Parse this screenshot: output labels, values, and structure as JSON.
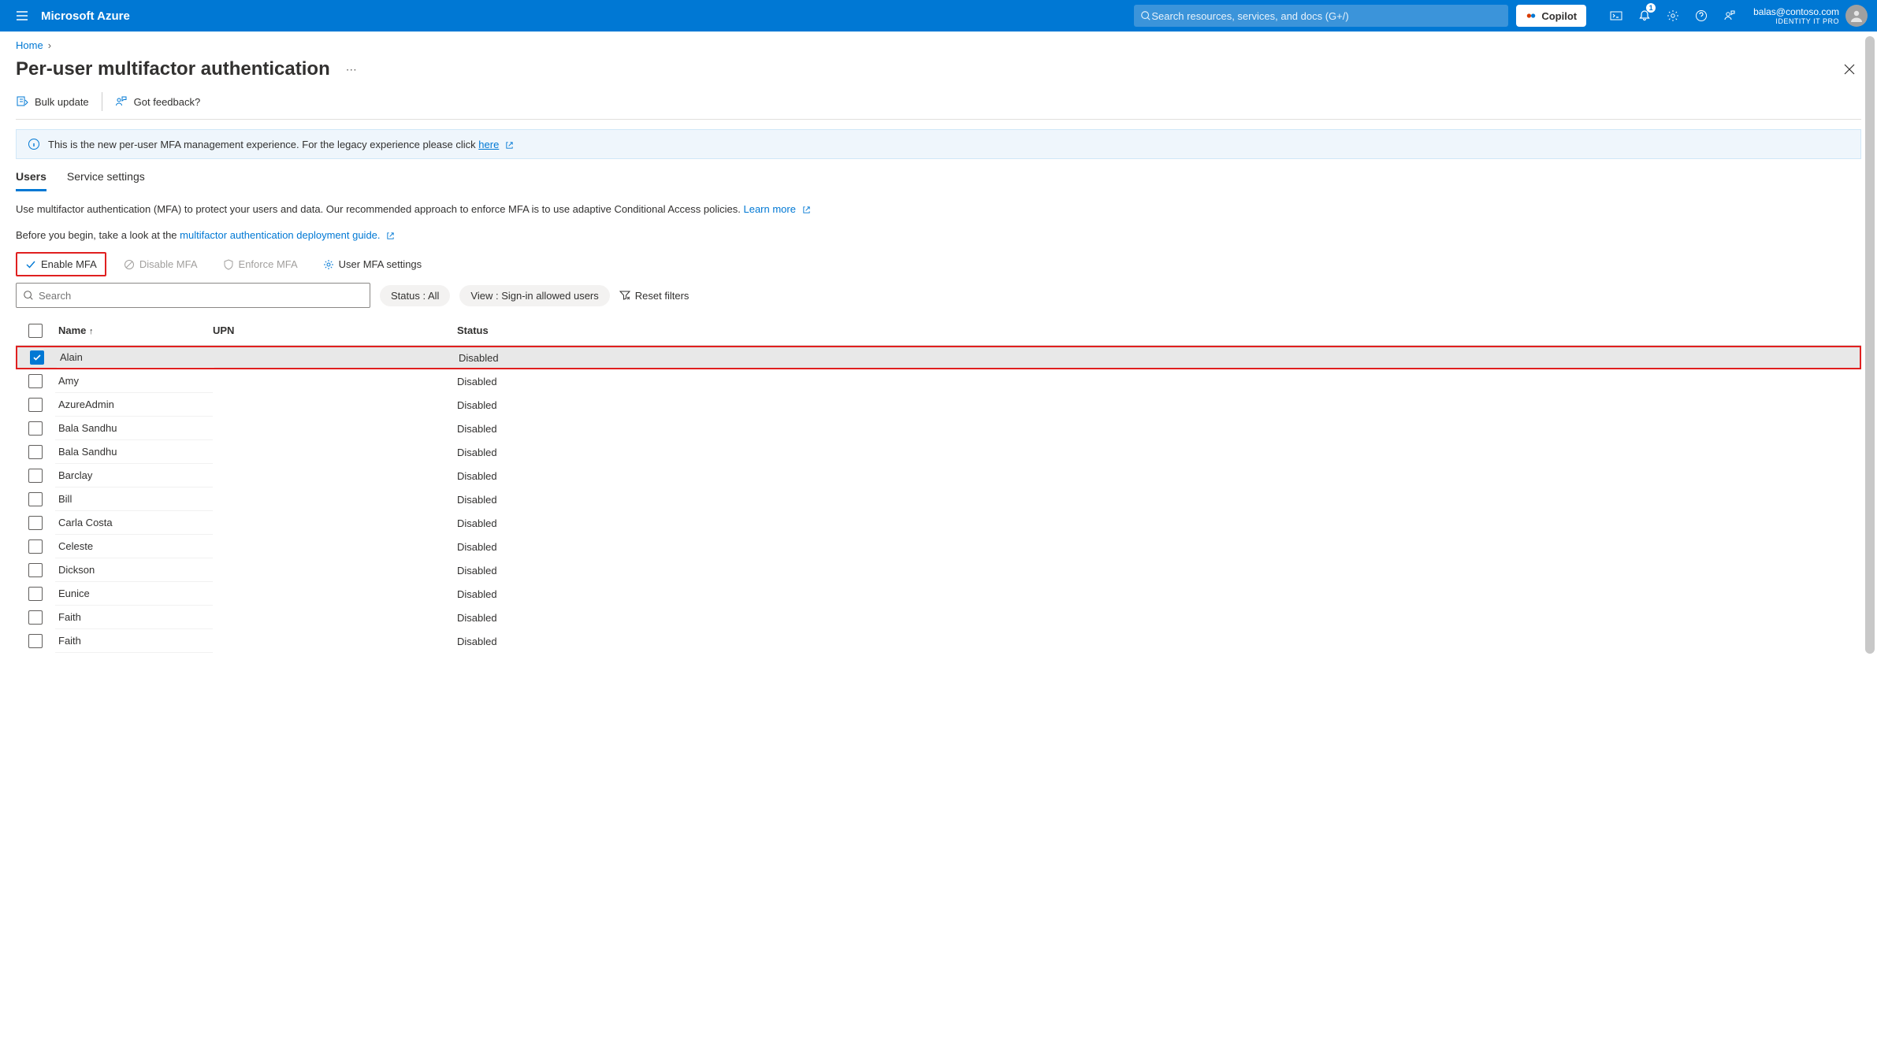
{
  "header": {
    "brand": "Microsoft Azure",
    "search_placeholder": "Search resources, services, and docs (G+/)",
    "copilot": "Copilot",
    "notification_count": "1",
    "account_email": "balas@contoso.com",
    "account_role": "IDENTITY IT PRO"
  },
  "breadcrumb": {
    "home": "Home"
  },
  "page": {
    "title": "Per-user multifactor authentication",
    "bulk_update": "Bulk update",
    "feedback": "Got feedback?"
  },
  "banner": {
    "text": "This is the new per-user MFA management experience. For the legacy experience please click ",
    "link": "here"
  },
  "tabs": {
    "users": "Users",
    "settings": "Service settings"
  },
  "intro": {
    "line1a": "Use multifactor authentication (MFA) to protect your users and data. Our recommended approach to enforce MFA is to use adaptive Conditional Access policies. ",
    "line1_link": "Learn more",
    "line2a": "Before you begin, take a look at the ",
    "line2_link": "multifactor authentication deployment guide."
  },
  "actions": {
    "enable": "Enable MFA",
    "disable": "Disable MFA",
    "enforce": "Enforce MFA",
    "user_settings": "User MFA settings"
  },
  "filters": {
    "search_placeholder": "Search",
    "status_pill": "Status : All",
    "view_pill": "View : Sign-in allowed users",
    "reset": "Reset filters"
  },
  "columns": {
    "name": "Name",
    "upn": "UPN",
    "status": "Status"
  },
  "rows": [
    {
      "name": "Alain",
      "upn": "",
      "status": "Disabled",
      "checked": true,
      "highlight": true
    },
    {
      "name": "Amy",
      "upn": "",
      "status": "Disabled",
      "checked": false
    },
    {
      "name": "AzureAdmin",
      "upn": "",
      "status": "Disabled",
      "checked": false
    },
    {
      "name": "Bala Sandhu",
      "upn": "",
      "status": "Disabled",
      "checked": false
    },
    {
      "name": "Bala Sandhu",
      "upn": "",
      "status": "Disabled",
      "checked": false
    },
    {
      "name": "Barclay",
      "upn": "",
      "status": "Disabled",
      "checked": false
    },
    {
      "name": "Bill",
      "upn": "",
      "status": "Disabled",
      "checked": false
    },
    {
      "name": "Carla Costa",
      "upn": "",
      "status": "Disabled",
      "checked": false
    },
    {
      "name": "Celeste",
      "upn": "",
      "status": "Disabled",
      "checked": false
    },
    {
      "name": "Dickson",
      "upn": "",
      "status": "Disabled",
      "checked": false
    },
    {
      "name": "Eunice",
      "upn": "",
      "status": "Disabled",
      "checked": false
    },
    {
      "name": "Faith",
      "upn": "",
      "status": "Disabled",
      "checked": false
    },
    {
      "name": "Faith",
      "upn": "",
      "status": "Disabled",
      "checked": false
    }
  ]
}
